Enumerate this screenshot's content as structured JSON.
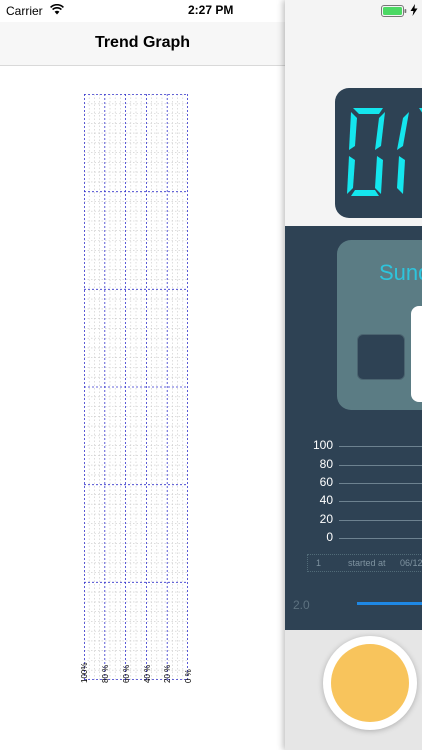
{
  "status_bar": {
    "carrier": "Carrier",
    "time": "2:27 PM"
  },
  "nav": {
    "title": "Trend Graph"
  },
  "trend_graph": {
    "tick_labels": [
      "100%",
      "80 %",
      "60 %",
      "40 %",
      "20 %",
      "0 %"
    ]
  },
  "device_panel": {
    "mode_label": "Sund",
    "scale": [
      "100",
      "80",
      "60",
      "40",
      "20",
      "0"
    ],
    "info": {
      "index": "1",
      "started": "started at",
      "date": "06/12"
    },
    "version": "2.0"
  },
  "colors": {
    "accent_cyan": "#2ec4dc",
    "panel_dark": "#2e4254",
    "mode_card": "#5b7c84",
    "button_yellow": "#f8c45c",
    "progress_blue": "#1e88e5",
    "grid_major": "#3333cc"
  }
}
